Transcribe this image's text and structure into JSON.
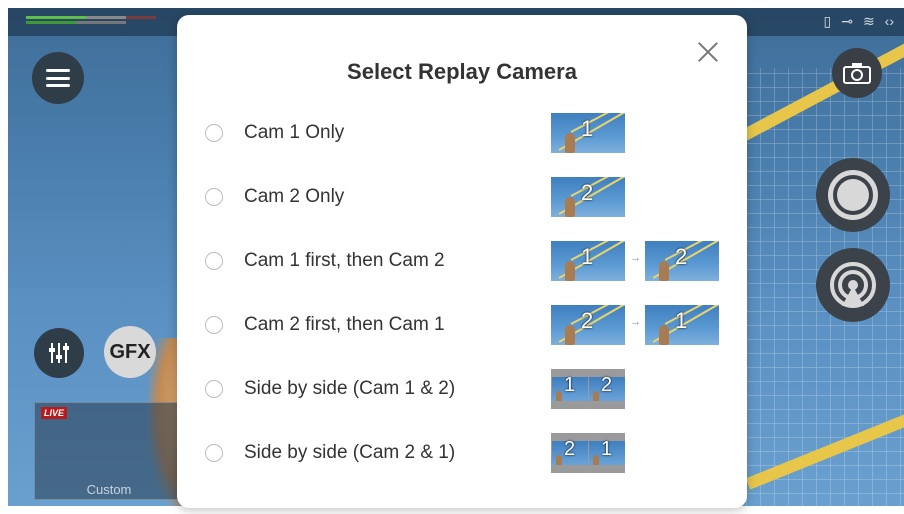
{
  "background": {
    "preview_live_badge": "LIVE",
    "preview_label": "Custom",
    "gfx_label": "GFX",
    "icons": [
      "menu-icon",
      "mixer-icon",
      "camera-icon",
      "record-icon",
      "broadcast-icon"
    ]
  },
  "dialog": {
    "title": "Select Replay Camera",
    "close_icon": "close-icon",
    "options": [
      {
        "label": "Cam 1 Only",
        "thumbs": [
          "1"
        ]
      },
      {
        "label": "Cam 2 Only",
        "thumbs": [
          "2"
        ]
      },
      {
        "label": "Cam 1 first, then Cam 2",
        "thumbs": [
          "1",
          "2"
        ]
      },
      {
        "label": "Cam 2 first, then Cam 1",
        "thumbs": [
          "2",
          "1"
        ]
      },
      {
        "label": "Side by side (Cam 1 & 2)",
        "split": [
          "1",
          "2"
        ]
      },
      {
        "label": "Side by side (Cam 2 & 1)",
        "split": [
          "2",
          "1"
        ]
      }
    ]
  }
}
